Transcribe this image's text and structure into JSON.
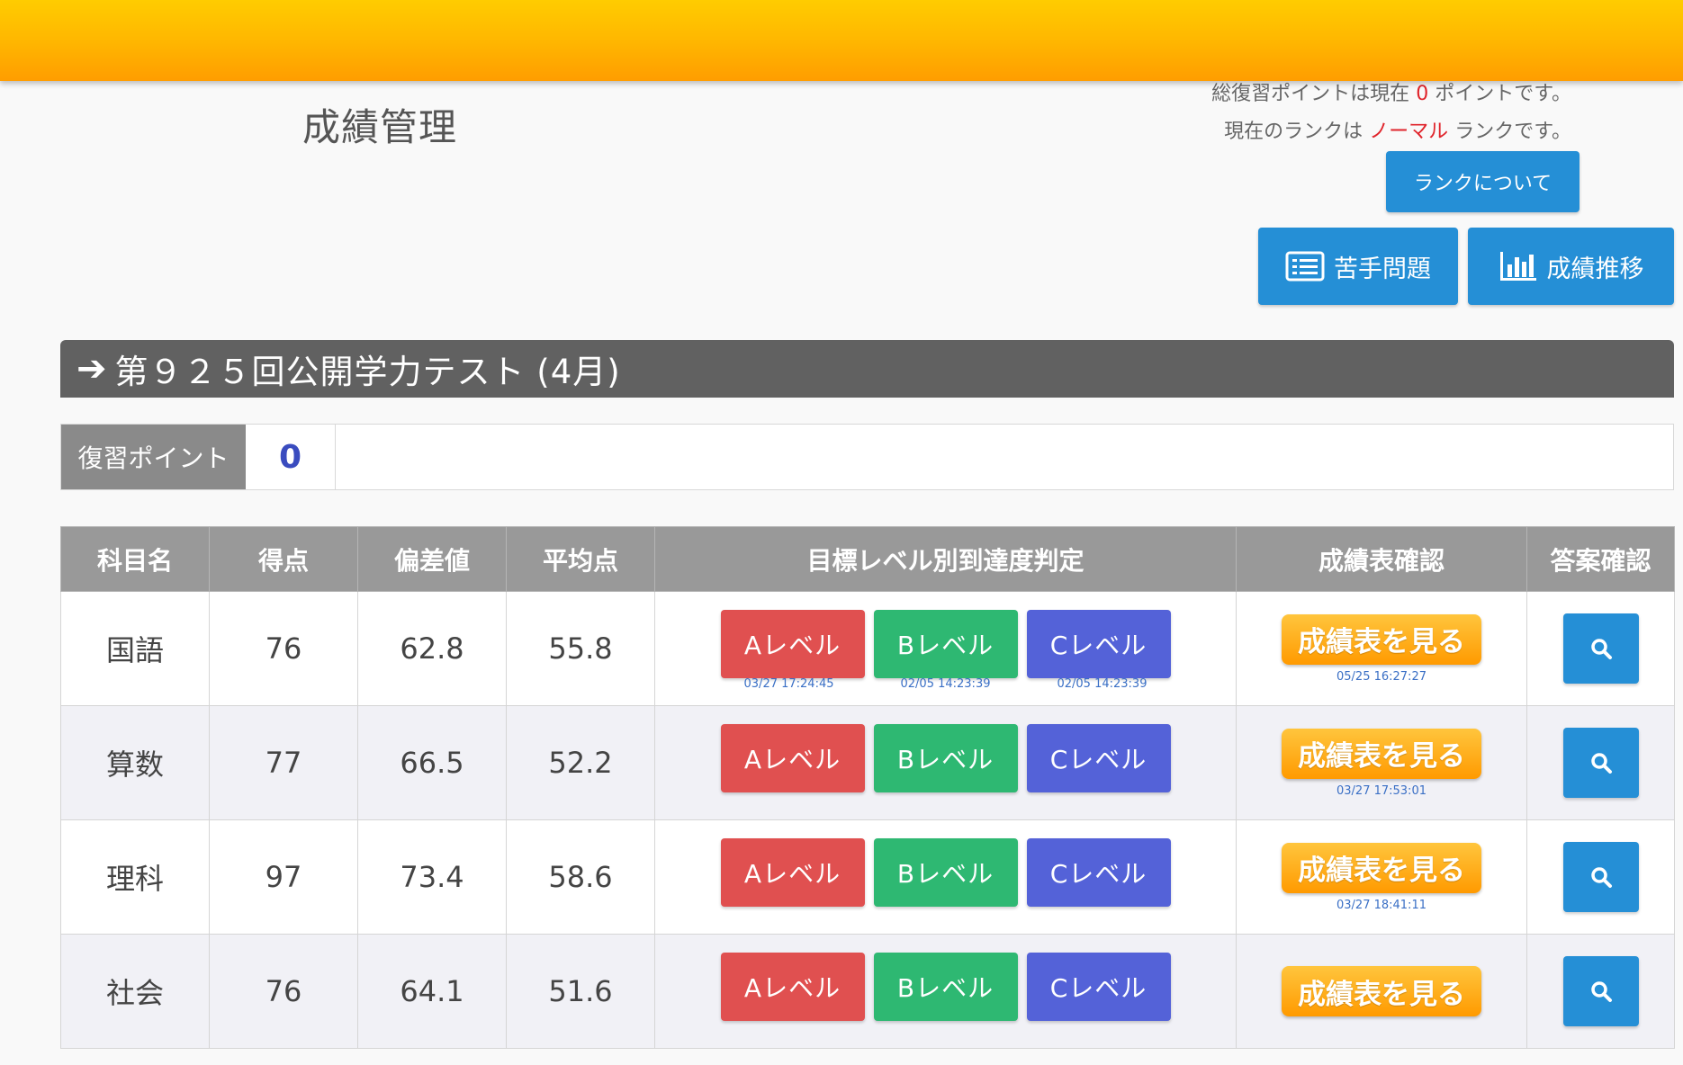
{
  "header": {
    "page_title": "成績管理",
    "points_line_prefix": "総復習ポイントは現在",
    "points_value": "0",
    "points_line_suffix": "ポイントです。",
    "rank_line_prefix": "現在のランクは",
    "rank_value": "ノーマル",
    "rank_line_suffix": "ランクです。",
    "rank_button": "ランクについて",
    "weak_button": "苦手問題",
    "trend_button": "成績推移"
  },
  "section": {
    "title": "第９２５回公開学力テスト (4月)"
  },
  "review": {
    "label": "復習ポイント",
    "value": "0"
  },
  "table": {
    "headers": [
      "科目名",
      "得点",
      "偏差値",
      "平均点",
      "目標レベル別到達度判定",
      "成績表確認",
      "答案確認"
    ],
    "level_labels": [
      "Aレベル",
      "Bレベル",
      "Cレベル"
    ],
    "view_label": "成績表を見る",
    "rows": [
      {
        "subject": "国語",
        "score": "76",
        "deviation": "62.8",
        "average": "55.8",
        "level_dates": [
          "03/27 17:24:45",
          "02/05 14:23:39",
          "02/05 14:23:39"
        ],
        "view_date": "05/25 16:27:27"
      },
      {
        "subject": "算数",
        "score": "77",
        "deviation": "66.5",
        "average": "52.2",
        "level_dates": [
          "",
          "",
          ""
        ],
        "view_date": "03/27 17:53:01"
      },
      {
        "subject": "理科",
        "score": "97",
        "deviation": "73.4",
        "average": "58.6",
        "level_dates": [
          "",
          "",
          ""
        ],
        "view_date": "03/27 18:41:11"
      },
      {
        "subject": "社会",
        "score": "76",
        "deviation": "64.1",
        "average": "51.6",
        "level_dates": [
          "",
          "",
          ""
        ],
        "view_date": ""
      }
    ]
  },
  "colors": {
    "topbar": "#ffb700",
    "primary_blue": "#258fd6",
    "level_a": "#e05050",
    "level_b": "#2eb872",
    "level_c": "#5462d8",
    "highlight_red": "#e0242b"
  }
}
